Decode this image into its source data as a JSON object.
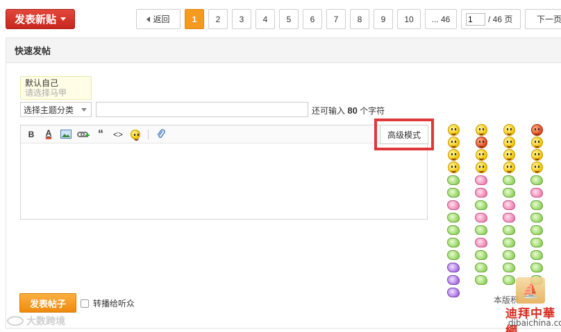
{
  "toolbar": {
    "new_post_label": "发表新贴"
  },
  "pager": {
    "back_label": "返回",
    "pages": [
      "1",
      "2",
      "3",
      "4",
      "5",
      "6",
      "7",
      "8",
      "9",
      "10"
    ],
    "current_page": "1",
    "ellipsis_label": "... 46",
    "input_value": "1",
    "total_label": "/ 46 页",
    "next_label": "下一页"
  },
  "quick_post": {
    "heading": "快速发帖",
    "identity_self": "默认自己",
    "identity_pick": "请选择马甲",
    "topic_select": "选择主题分类",
    "title_value": "",
    "char_left_prefix": "还可输入",
    "char_left_count": "80",
    "char_left_suffix": "个字符",
    "advanced_mode_label": "高级模式",
    "submit_label": "发表帖子",
    "forward_label": "转播给听众",
    "copyright_text": "本版积"
  },
  "editor_tools": {
    "bold": "B",
    "font_color": "A",
    "quote": "“",
    "code": "<>"
  },
  "emoticons": [
    "face",
    "face",
    "face",
    "face-red",
    "face",
    "face-red",
    "face",
    "face",
    "face",
    "face",
    "face",
    "face",
    "face",
    "face",
    "face",
    "face",
    "blob",
    "blob-pink",
    "blob",
    "blob",
    "blob",
    "blob-pink",
    "blob",
    "blob-pink",
    "blob-pink",
    "blob",
    "blob-pink",
    "blob",
    "blob",
    "blob-pink",
    "blob-pink",
    "blob",
    "blob",
    "blob",
    "blob",
    "blob",
    "blob",
    "blob-pink",
    "blob",
    "blob",
    "blob",
    "blob",
    "blob",
    "blob",
    "blob-purple",
    "blob",
    "blob",
    "blob",
    "blob-purple",
    "blob",
    "blob",
    "blob",
    "blob-purple",
    "",
    "",
    ""
  ],
  "watermarks": {
    "left_text": "大数跨境",
    "right_cn": "迪拜中華網",
    "right_en": "dibaichina.com"
  },
  "colors": {
    "new_post_red": "#d0302a",
    "active_page_orange": "#f49a1f",
    "submit_orange": "#f39a20",
    "highlight_red": "#e0373b"
  }
}
